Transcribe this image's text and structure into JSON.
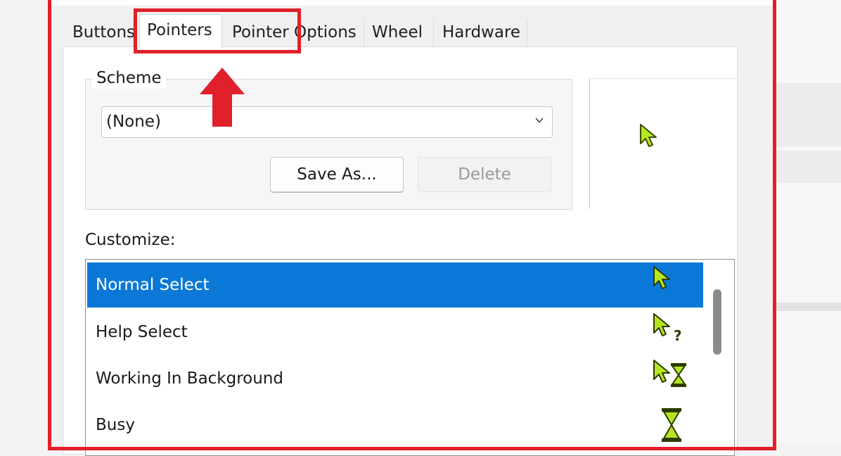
{
  "tabs": [
    {
      "label": "Buttons",
      "active": false
    },
    {
      "label": "Pointers",
      "active": true
    },
    {
      "label": "Pointer Options",
      "active": false
    },
    {
      "label": "Wheel",
      "active": false
    },
    {
      "label": "Hardware",
      "active": false
    }
  ],
  "scheme": {
    "group_label": "Scheme",
    "selected_value": "(None)",
    "save_as_label": "Save As...",
    "delete_label": "Delete"
  },
  "customize": {
    "label": "Customize:",
    "items": [
      {
        "label": "Normal Select",
        "icon": "arrow-cursor-icon",
        "selected": true
      },
      {
        "label": "Help Select",
        "icon": "help-cursor-icon",
        "selected": false
      },
      {
        "label": "Working In Background",
        "icon": "working-cursor-icon",
        "selected": false
      },
      {
        "label": "Busy",
        "icon": "hourglass-cursor-icon",
        "selected": false
      }
    ]
  },
  "colors": {
    "highlight_red": "#e0202a",
    "selection_blue": "#0b78d7",
    "cursor_green": "#b4e61e"
  }
}
